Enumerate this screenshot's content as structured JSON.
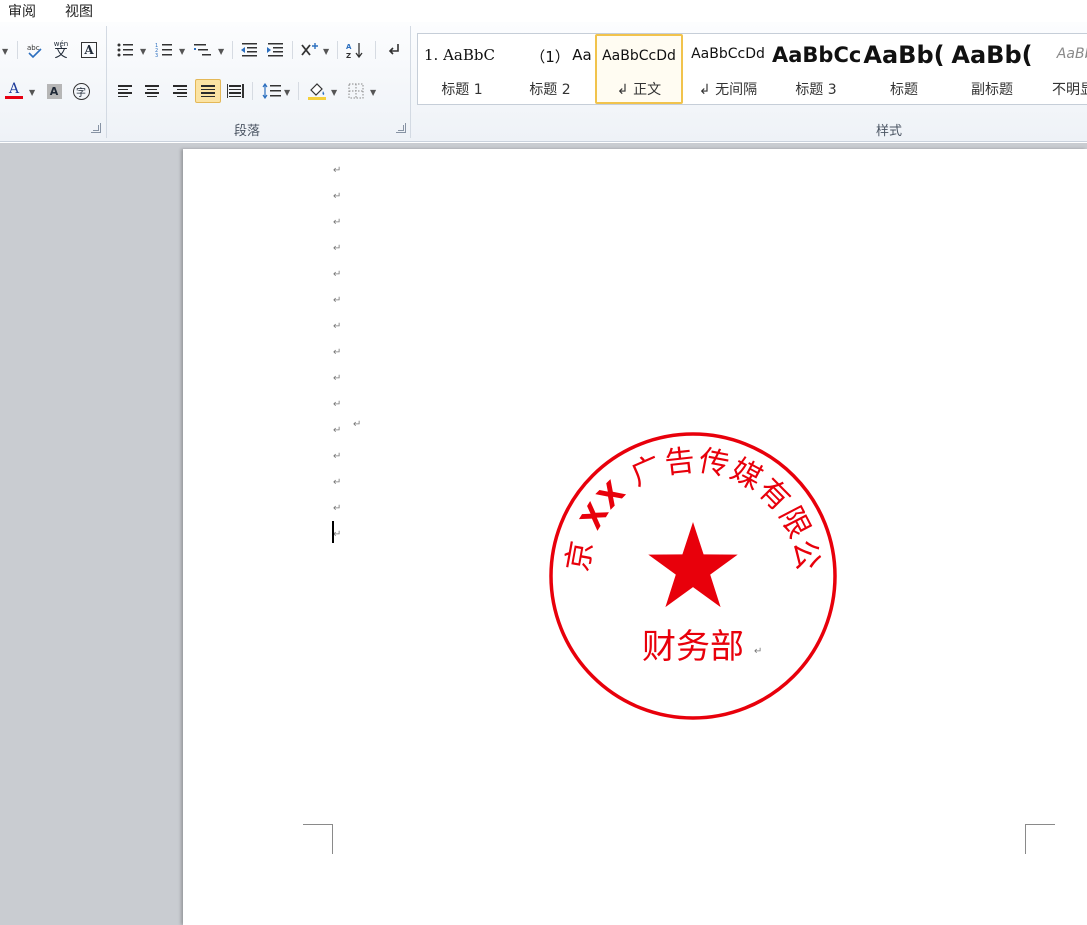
{
  "menu": {
    "tabs": [
      "审阅",
      "视图"
    ]
  },
  "ribbon": {
    "groups": {
      "paragraph_label": "段落",
      "styles_label": "样式"
    },
    "styles": [
      {
        "sample": "1.  AaBbC",
        "name": "标题 1"
      },
      {
        "sample": "（1）",
        "name": "标题 2"
      },
      {
        "sample": "Aa",
        "name": ""
      },
      {
        "sample": "AaBbCcDd",
        "name": "↲ 正文",
        "selected": true
      },
      {
        "sample": "AaBbCcDd",
        "name": "↲ 无间隔"
      },
      {
        "sample": "AaBbCc",
        "name": "标题 3"
      },
      {
        "sample": "AaBb(",
        "name": "标题"
      },
      {
        "sample": "AaBb(",
        "name": "副标题"
      },
      {
        "sample": "AaBbC",
        "name": "不明显强"
      }
    ],
    "icons": {
      "bullets": "bullet-list-icon",
      "numbering": "numbered-list-icon",
      "multilevel": "multilevel-list-icon",
      "decrease_indent": "decrease-indent-icon",
      "increase_indent": "increase-indent-icon",
      "chinese_layout": "chinese-layout-icon",
      "sort": "sort-icon",
      "show_marks": "paragraph-mark-icon",
      "align_left": "align-left-icon",
      "align_center": "align-center-icon",
      "align_right": "align-right-icon",
      "justify": "justify-icon",
      "distributed": "distributed-icon",
      "line_spacing": "line-spacing-icon",
      "shading": "shading-icon",
      "borders": "borders-icon",
      "font_color": "font-color-icon",
      "char_shading": "character-shading-icon",
      "enclose": "enclosed-character-icon",
      "phonetic": "phonetic-guide-icon",
      "character_border": "character-border-icon"
    },
    "font_color_letter": "A",
    "char_shading_letter": "A",
    "enclose_char": "字",
    "phonetic_text": "wén",
    "phonetic_char": "文",
    "char_border_letter": "A"
  },
  "document": {
    "paragraph_mark": "↵",
    "stamp": {
      "arc_text": "北京 XX 广告传媒有限公司",
      "arc_prefix": "北京",
      "arc_bold": "XX",
      "arc_suffix": "广告传媒有限公司",
      "department": "财务部",
      "color": "#e8000b"
    }
  },
  "colors": {
    "stamp_red": "#e8000b",
    "selected_style_border": "#f1c34c",
    "font_color_bar": "#e60012"
  }
}
